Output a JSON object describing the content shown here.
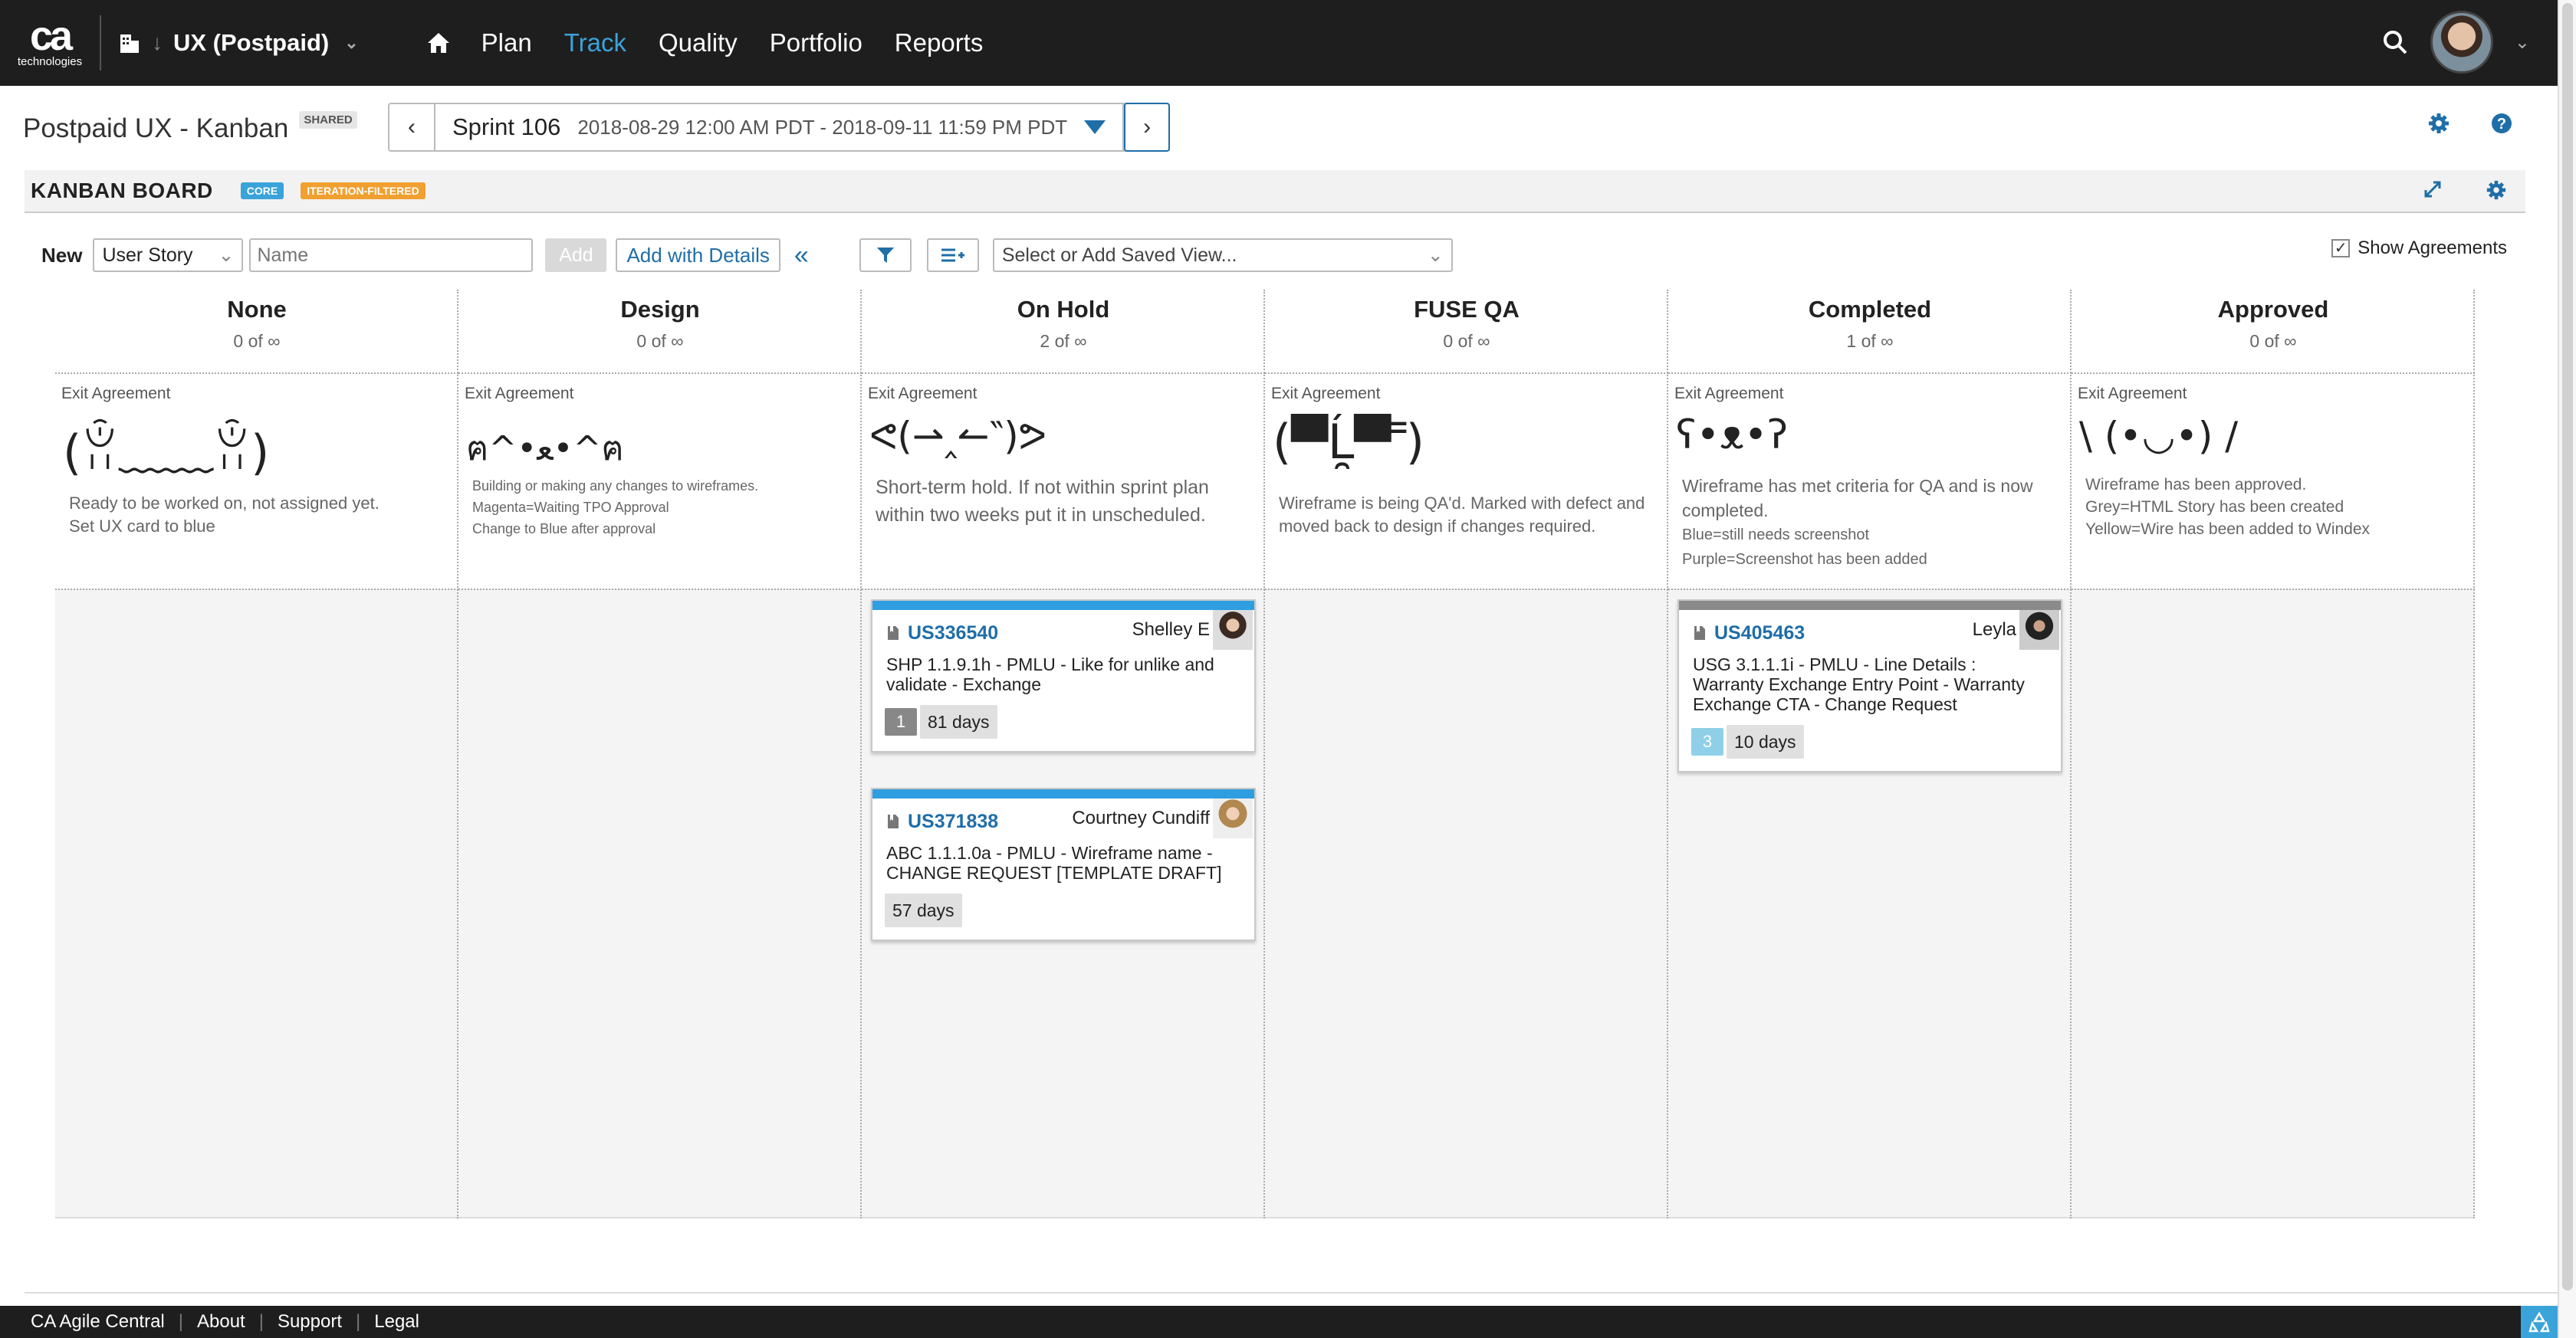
{
  "brand": {
    "logo_text": "ca",
    "logo_sub": "technologies"
  },
  "nav": {
    "workspace": "UX (Postpaid)",
    "links": [
      {
        "label": "Plan"
      },
      {
        "label": "Track"
      },
      {
        "label": "Quality"
      },
      {
        "label": "Portfolio"
      },
      {
        "label": "Reports"
      }
    ],
    "active": "Track"
  },
  "page": {
    "title": "Postpaid UX - Kanban",
    "shared_badge": "SHARED"
  },
  "sprint": {
    "name": "Sprint 106",
    "dates": "2018-08-29 12:00 AM PDT - 2018-09-11 11:59 PM PDT"
  },
  "kanban": {
    "title": "KANBAN BOARD",
    "tag_core": "CORE",
    "tag_filter": "ITERATION-FILTERED"
  },
  "toolbar": {
    "new_label": "New",
    "type_value": "User Story",
    "name_placeholder": "Name",
    "add_label": "Add",
    "add_details_label": "Add with Details",
    "collapse_glyph": "«",
    "saved_view_placeholder": "Select or Add Saved View...",
    "show_agreements_label": "Show Agreements",
    "show_agreements_checked": true
  },
  "columns": [
    {
      "name": "None",
      "count": "0 of ∞",
      "agreement_label": "Exit Agreement",
      "face": "(ꂧ﹏﹏ꂧ)",
      "desc": [
        "Ready to be worked on, not assigned yet.",
        "Set UX card to blue"
      ]
    },
    {
      "name": "Design",
      "count": "0 of ∞",
      "agreement_label": "Exit Agreement",
      "face": "ฅ^•ﻌ•^ฅ",
      "desc": [
        "Building or making any changes to wireframes.",
        "Magenta=Waiting TPO Approval",
        "Change to Blue after approval"
      ]
    },
    {
      "name": "On Hold",
      "count": "2 of ∞",
      "agreement_label": "Exit Agreement",
      "face": "ᕙ(⇀‸↼‶)ᕗ",
      "desc": [
        "Short-term hold. If not within sprint plan",
        "within two weeks put it in unscheduled."
      ]
    },
    {
      "name": "FUSE QA",
      "count": "0 of ∞",
      "agreement_label": "Exit Agreement",
      "face": "(▀̿Ĺ̯▀̿ ̿)",
      "desc": [
        "Wireframe is being QA'd. Marked with defect and",
        "moved back to design if changes required."
      ]
    },
    {
      "name": "Completed",
      "count": "1 of ∞",
      "agreement_label": "Exit Agreement",
      "face": "ʕ•ᴥ•ʔ",
      "desc": [
        "Wireframe has met criteria for QA and is now",
        "completed.",
        "Blue=still needs screenshot",
        "Purple=Screenshot has been added"
      ]
    },
    {
      "name": "Approved",
      "count": "0 of ∞",
      "agreement_label": "Exit Agreement",
      "face": "\\ (•◡•) /",
      "desc": [
        "Wireframe has been approved.",
        "Grey=HTML Story has been created",
        "Yellow=Wire has been added to Windex"
      ]
    }
  ],
  "cards": [
    {
      "column": 2,
      "id": "US336540",
      "owner": "Shelley E",
      "title": "SHP 1.1.9.1h - PMLU - Like for unlike and validate - Exchange",
      "comments": "1",
      "days": "81 days",
      "color": "#2e9ee0"
    },
    {
      "column": 2,
      "id": "US371838",
      "owner": "Courtney Cundiff",
      "title": "ABC 1.1.1.0a - PMLU - Wireframe name - CHANGE REQUEST [TEMPLATE DRAFT]",
      "comments": "",
      "days": "57 days",
      "color": "#2e9ee0"
    },
    {
      "column": 4,
      "id": "US405463",
      "owner": "Leyla",
      "title": "USG 3.1.1.1i - PMLU - Line Details : Warranty Exchange Entry Point - Warranty Exchange CTA - Change Request",
      "comments": "3",
      "days": "10 days",
      "color": "#8a8a8a"
    }
  ],
  "footer": {
    "links": [
      "CA Agile Central",
      "About",
      "Support",
      "Legal"
    ]
  },
  "colors": {
    "nav_bg": "#1e1e1e",
    "accent": "#3aa3d9",
    "link": "#1e6ea8",
    "core_tag": "#3aa3d9",
    "filter_tag": "#f0a030"
  }
}
